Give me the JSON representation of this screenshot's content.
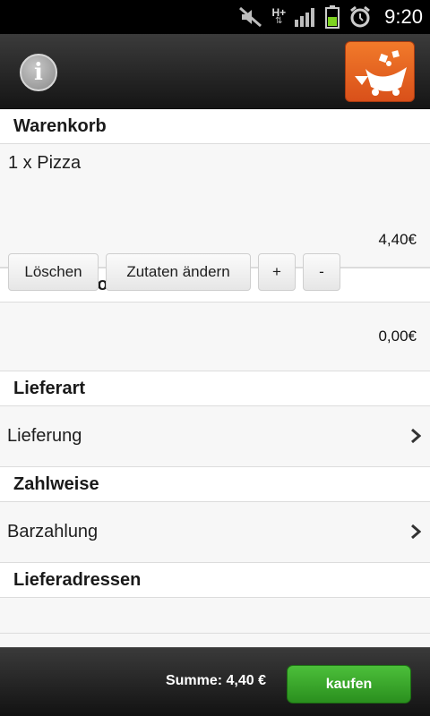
{
  "status_bar": {
    "time": "9:20",
    "network_label": "H+"
  },
  "cart": {
    "header": "Warenkorb",
    "item": {
      "name": "1 x Pizza",
      "price": "4,40€"
    },
    "buttons": {
      "delete": "Löschen",
      "edit": "Zutaten ändern",
      "plus": "+",
      "minus": "-"
    }
  },
  "fees": {
    "header": "Anfahrtskosten",
    "price": "0,00€"
  },
  "delivery": {
    "header": "Lieferart",
    "value": "Lieferung"
  },
  "payment": {
    "header": "Zahlweise",
    "value": "Barzahlung"
  },
  "addresses": {
    "header": "Lieferadressen"
  },
  "footer": {
    "total": "Summe: 4,40 €",
    "buy_label": "kaufen"
  },
  "icons": {
    "info": "info-icon",
    "cart": "cart-icon",
    "mute": "mute-icon",
    "signal": "signal-icon",
    "battery": "battery-icon",
    "alarm": "alarm-icon",
    "chevron": "chevron-right-icon"
  },
  "colors": {
    "accent_orange": "#e86a24",
    "buy_green": "#3aa52a",
    "battery_green": "#7ed321"
  }
}
